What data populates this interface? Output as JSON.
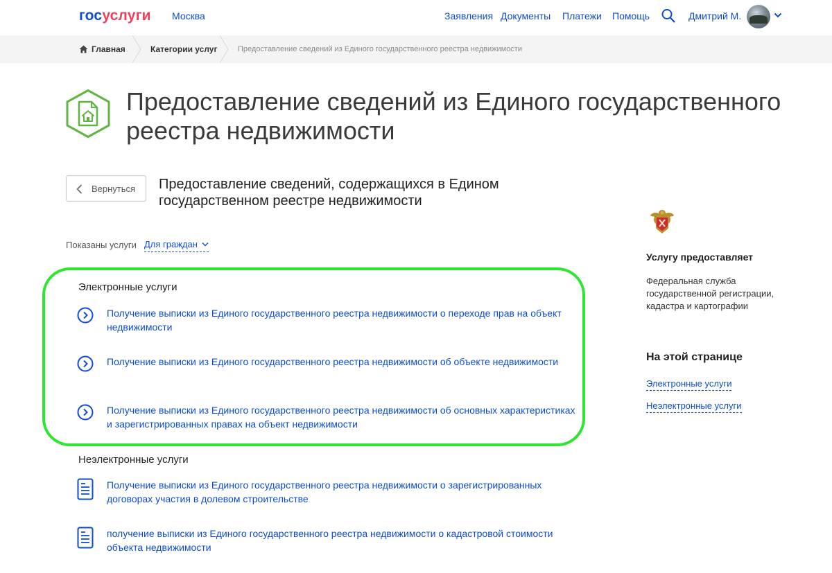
{
  "header": {
    "logo_part1": "гос",
    "logo_part2": "услуги",
    "city": "Москва",
    "nav": [
      "Заявления",
      "Документы",
      "Платежи",
      "Помощь"
    ],
    "user_name": "Дмитрий М."
  },
  "breadcrumb": {
    "home": "Главная",
    "categories": "Категории услуг",
    "current": "Предоставление сведений из Единого государственного реестра недвижимости"
  },
  "page": {
    "title": "Предоставление сведений из Единого государственного реестра недвижимости",
    "back_label": "Вернуться",
    "subtitle": "Предоставление сведений, содержащихся в Едином государственном реестре недвижимости",
    "shown_label": "Показаны услуги",
    "filter_value": "Для граждан"
  },
  "electronic": {
    "heading": "Электронные услуги",
    "items": [
      "Получение выписки из Единого государственного реестра недвижимости о переходе прав на объект недвижимости",
      "Получение выписки из Единого государственного реестра недвижимости об объекте недвижимости",
      "Получение выписки из Единого государственного реестра недвижимости об основных характеристиках и зарегистрированных правах на объект недвижимости"
    ]
  },
  "non_electronic": {
    "heading": "Неэлектронные услуги",
    "items": [
      "Получение выписки из Единого государственного реестра недвижимости о зарегистрированных договорах участия в долевом строительстве",
      "получение выписки из Единого государственного реестра недвижимости о кадастровой стоимости объекта недвижимости"
    ]
  },
  "sidebar": {
    "provider_heading": "Услугу предоставляет",
    "provider_name": "Федеральная служба государственной регистрации, кадастра и картографии",
    "onpage_heading": "На этой странице",
    "onpage_links": [
      "Электронные услуги",
      "Неэлектронные услуги"
    ]
  },
  "colors": {
    "link": "#0d4cd3",
    "logo_red": "#ee3f58",
    "highlight": "#2ee530",
    "service_icon_green": "#5fb540"
  }
}
